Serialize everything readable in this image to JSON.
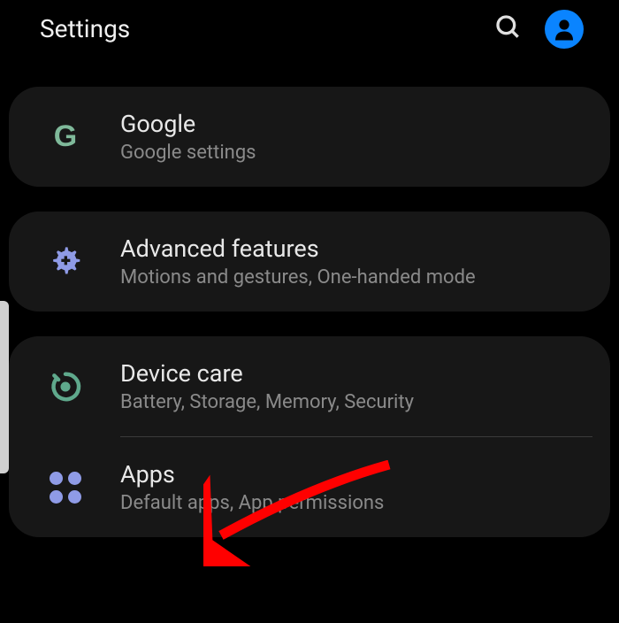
{
  "header": {
    "title": "Settings"
  },
  "groups": [
    {
      "items": [
        {
          "id": "google",
          "title": "Google",
          "subtitle": "Google settings"
        }
      ]
    },
    {
      "items": [
        {
          "id": "advanced-features",
          "title": "Advanced features",
          "subtitle": "Motions and gestures, One-handed mode"
        }
      ]
    },
    {
      "items": [
        {
          "id": "device-care",
          "title": "Device care",
          "subtitle": "Battery, Storage, Memory, Security"
        },
        {
          "id": "apps",
          "title": "Apps",
          "subtitle": "Default apps, App permissions"
        }
      ]
    }
  ],
  "colors": {
    "google_icon": "#7fb99a",
    "gear_icon": "#8f9be6",
    "device_care_icon": "#5fa98c",
    "apps_icon": "#8f9be6",
    "avatar_bg": "#0a84ff",
    "arrow": "#ff0000"
  }
}
